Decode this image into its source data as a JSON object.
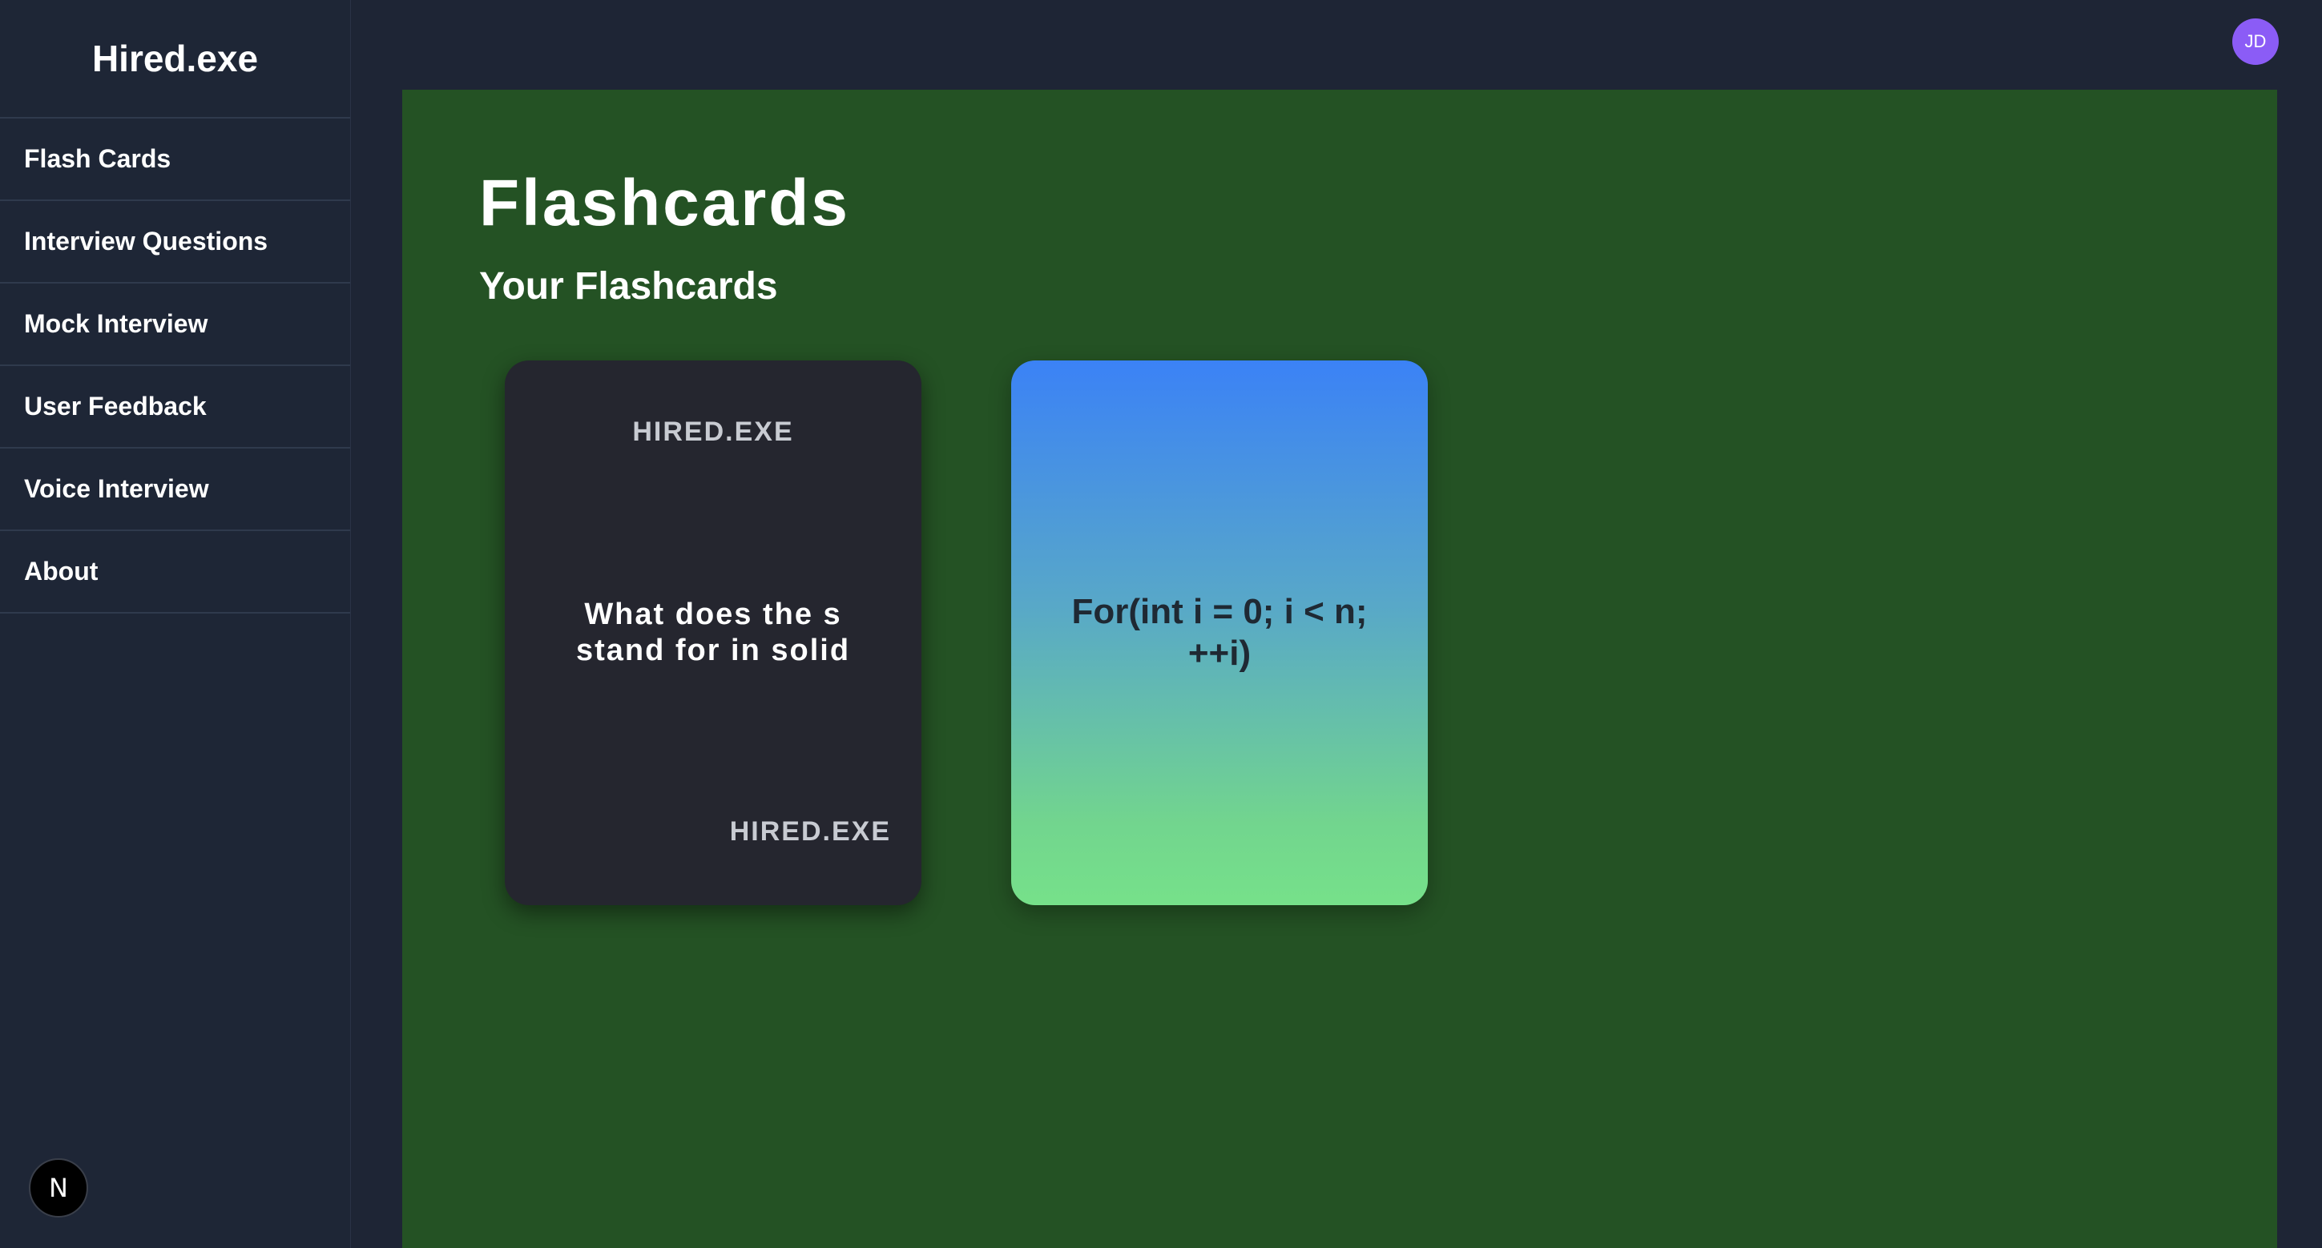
{
  "sidebar": {
    "brand": "Hired.exe",
    "items": [
      {
        "label": "Flash Cards"
      },
      {
        "label": "Interview Questions"
      },
      {
        "label": "Mock Interview"
      },
      {
        "label": "User Feedback"
      },
      {
        "label": "Voice Interview"
      },
      {
        "label": "About"
      }
    ],
    "badge_label": "N"
  },
  "header": {
    "avatar_initials": "JD"
  },
  "main": {
    "title": "Flashcards",
    "subtitle": "Your Flashcards",
    "cards": [
      {
        "style": "dark",
        "brand_top": "HIRED.EXE",
        "text": "What does the s stand for in solid",
        "brand_bottom": "HIRED.EXE"
      },
      {
        "style": "gradient",
        "text": "For(int i = 0; i < n; ++i)"
      }
    ],
    "fab_icon": "plus-icon"
  },
  "colors": {
    "background": "#1e2535",
    "sidebar": "#1e2636",
    "main_panel": "#245224",
    "card_dark": "#25262f",
    "gradient_start": "#3b82f6",
    "gradient_end": "#76e18a",
    "avatar": "#8b5cf6"
  }
}
